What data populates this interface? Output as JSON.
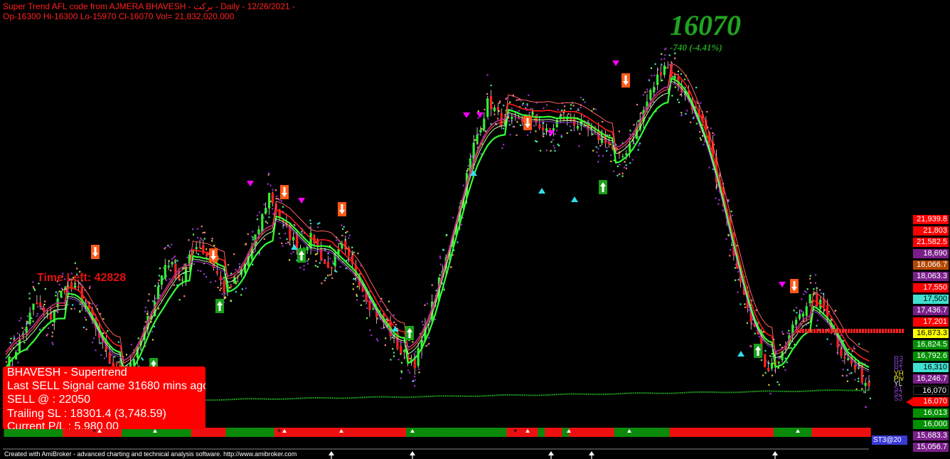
{
  "header": {
    "line1": "Super Trend AFL code from AJMERA BHAVESH  - برکت - Daily  - 12/26/2021 -",
    "line2": "Op-16300  Hi-16300  Lo-15970  Cl-16070  Vol= 21,832,020.000"
  },
  "big_price": "16070",
  "big_change": "-740  (-4.41%)",
  "time_left": "Time Left: 42828",
  "info_box": {
    "title": "BHAVESH - Supertrend",
    "signal": "Last SELL Signal came 31680 mins ago",
    "entry": "SELL @ : 22050",
    "trailing": "Trailing SL : 18301.4 (3,748.59)",
    "pl": "Current P/L : 5,980.00"
  },
  "footer": "Created with AmiBroker - advanced charting and technical analysis software. http://www.amibroker.com",
  "status_chip": "ST3@20",
  "pivot_labels": [
    "R3",
    "R2",
    "R1",
    "YH",
    "Piv",
    "YL",
    "S1",
    "S2",
    "S3"
  ],
  "colors": {
    "bull": "#33ee33",
    "bear": "#ff2020",
    "supertrend_green": "#33ff33",
    "supertrend_red": "#ff1a1a",
    "purple": "#9933cc",
    "volume_ma": "#1f9f1f"
  },
  "chart_data": {
    "type": "candlestick",
    "last_close": 16070,
    "close_series": [
      16400,
      16900,
      17600,
      17300,
      17900,
      17800,
      17200,
      16550,
      16300,
      16700,
      17500,
      18400,
      18000,
      18700,
      18400,
      17800,
      18100,
      18700,
      19600,
      19000,
      18600,
      18800,
      18200,
      18600,
      18100,
      17500,
      17200,
      16700,
      16500,
      17400,
      18300,
      19300,
      20500,
      21300,
      20900,
      20900,
      21000,
      20700,
      21000,
      20900,
      20700,
      20600,
      20200,
      20700,
      21400,
      22000,
      21600,
      21200,
      20600,
      19400,
      18300,
      17300,
      16400,
      16550,
      17300,
      17700,
      17500,
      16750,
      16400,
      16070
    ],
    "buy_arrows": [
      "Up arrow 1",
      "Up arrow 2",
      "Up arrow 3",
      "Up arrow 4",
      "Up arrow 5",
      "Up arrow 6"
    ],
    "sell_arrows": [
      "Down arrow 1",
      "Down arrow 2",
      "Down arrow 3",
      "Down arrow 4",
      "Down arrow 5",
      "Down arrow 6",
      "Down arrow 7"
    ],
    "price_scale": [
      {
        "label": "21,939.8",
        "bg": "#ff0000",
        "fg": "#ffffff"
      },
      {
        "label": "21,803",
        "bg": "#ff0000",
        "fg": "#ffffff"
      },
      {
        "label": "21,582.5",
        "bg": "#ff0000",
        "fg": "#ffffff"
      },
      {
        "label": "18,690",
        "bg": "#7a1f8a",
        "fg": "#ffffff"
      },
      {
        "label": "18,066.7",
        "bg": "#b34700",
        "fg": "#ffffff"
      },
      {
        "label": "18,063.3",
        "bg": "#7a1f8a",
        "fg": "#ffffff"
      },
      {
        "label": "17,550",
        "bg": "#ff0000",
        "fg": "#ffffff"
      },
      {
        "label": "17,500",
        "bg": "#40e0d0",
        "fg": "#000000"
      },
      {
        "label": "17,436.7",
        "bg": "#7a1f8a",
        "fg": "#ffffff"
      },
      {
        "label": "17,201",
        "bg": "#ff0000",
        "fg": "#ffffff"
      },
      {
        "label": "16,873.3",
        "bg": "#ffff00",
        "fg": "#000000"
      },
      {
        "label": "16,824.5",
        "bg": "#009000",
        "fg": "#ffffff"
      },
      {
        "label": "16,792.6",
        "bg": "#009000",
        "fg": "#ffffff"
      },
      {
        "label": "16,310",
        "bg": "#40e0d0",
        "fg": "#000000"
      },
      {
        "label": "16,246.7",
        "bg": "#7a1f8a",
        "fg": "#ffffff"
      },
      {
        "label": "16,070",
        "bg": "#000000",
        "fg": "#ffffff"
      },
      {
        "label": "16,070",
        "bg": "#ff0000",
        "fg": "#ffffff"
      },
      {
        "label": "16,013",
        "bg": "#009000",
        "fg": "#ffffff"
      },
      {
        "label": "16,000",
        "bg": "#009000",
        "fg": "#ffffff"
      },
      {
        "label": "15,683.3",
        "bg": "#7a1f8a",
        "fg": "#ffffff"
      },
      {
        "label": "15,056.7",
        "bg": "#7a1f8a",
        "fg": "#ffffff"
      }
    ]
  }
}
